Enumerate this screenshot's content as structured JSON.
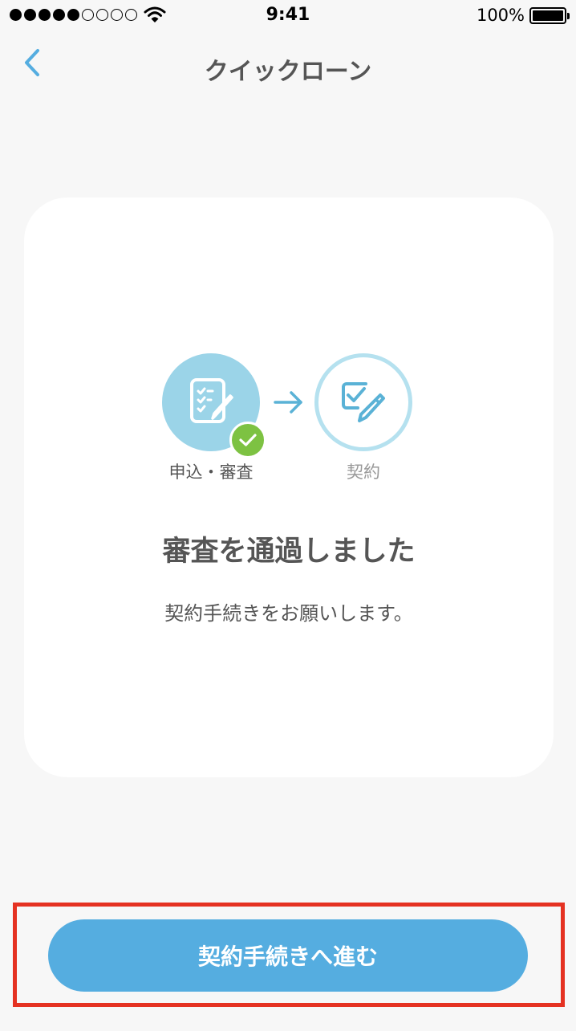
{
  "status_bar": {
    "time": "9:41",
    "battery": "100%",
    "signal_filled": 5,
    "signal_empty": 4
  },
  "nav": {
    "title": "クイックローン",
    "back_icon": "chevron-left-icon"
  },
  "steps": {
    "step1_label": "申込・審査",
    "step2_label": "契約",
    "step1_status": "completed",
    "step2_status": "current"
  },
  "result": {
    "title": "審査を通過しました",
    "subtitle": "契約手続きをお願いします。"
  },
  "action": {
    "button_label": "契約手続きへ進む"
  },
  "colors": {
    "accent": "#55ade0",
    "step_fill": "#9bd4e8",
    "success": "#7dc242",
    "highlight": "#e53222"
  }
}
